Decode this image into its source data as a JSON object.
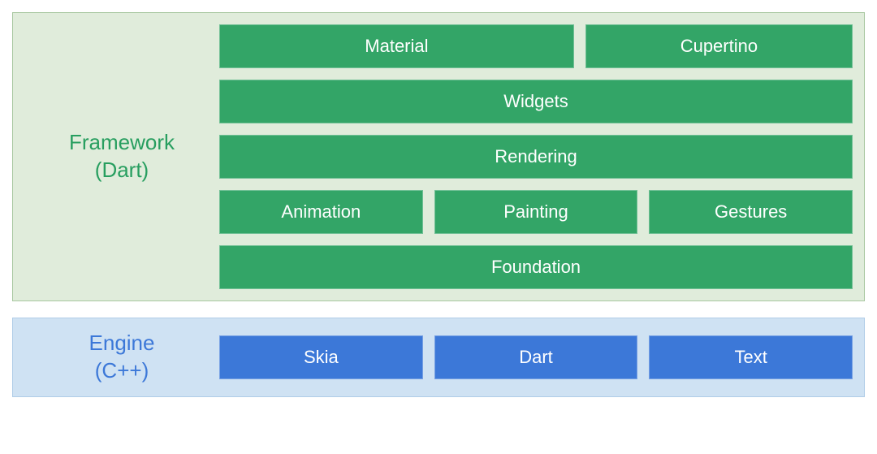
{
  "framework": {
    "label_line1": "Framework",
    "label_line2": "(Dart)",
    "rows": {
      "top": {
        "material": "Material",
        "cupertino": "Cupertino"
      },
      "widgets": "Widgets",
      "rendering": "Rendering",
      "mid": {
        "animation": "Animation",
        "painting": "Painting",
        "gestures": "Gestures"
      },
      "foundation": "Foundation"
    }
  },
  "engine": {
    "label_line1": "Engine",
    "label_line2": "(C++)",
    "row": {
      "skia": "Skia",
      "dart": "Dart",
      "text": "Text"
    }
  },
  "colors": {
    "framework_bg": "#e0ecdb",
    "framework_block": "#33a567",
    "framework_text": "#279e5f",
    "engine_bg": "#cfe2f3",
    "engine_block": "#3c78d8",
    "engine_text": "#3c78d8"
  }
}
